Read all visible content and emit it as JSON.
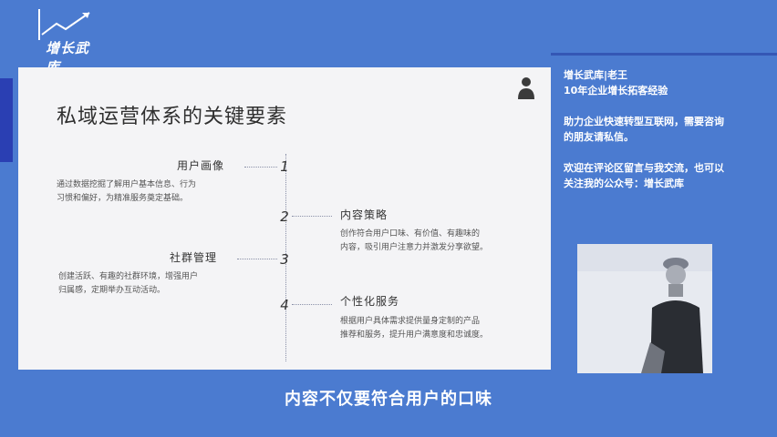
{
  "logo": {
    "text": "增长武库",
    "icon": "growth-arrow-icon"
  },
  "slide": {
    "title": "私域运营体系的关键要素",
    "items": [
      {
        "num": "1",
        "title": "用户画像",
        "desc_lines": [
          "通过数据挖掘了解用户基本信息、行为",
          "习惯和偏好，为精准服务奠定基础。"
        ]
      },
      {
        "num": "2",
        "title": "内容策略",
        "desc_lines": [
          "创作符合用户口味、有价值、有趣味的",
          "内容，吸引用户注意力并激发分享欲望。"
        ]
      },
      {
        "num": "3",
        "title": "社群管理",
        "desc_lines": [
          "创建活跃、有趣的社群环境，增强用户",
          "归属感，定期举办互动活动。"
        ]
      },
      {
        "num": "4",
        "title": "个性化服务",
        "desc_lines": [
          "根据用户具体需求提供量身定制的产品",
          "推荐和服务，提升用户满意度和忠诚度。"
        ]
      }
    ]
  },
  "side": {
    "lines": [
      "增长武库|老王",
      "10年企业增长拓客经验",
      "",
      "助力企业快速转型互联网，需要咨询",
      "的朋友请私信。",
      "",
      "欢迎在评论区留言与我交流，也可以",
      "关注我的公众号：增长武库"
    ]
  },
  "subtitle": "内容不仅要符合用户的口味",
  "colors": {
    "background": "#4b7bd0",
    "slide": "#f4f4f6",
    "accent": "#2a3fb3"
  }
}
